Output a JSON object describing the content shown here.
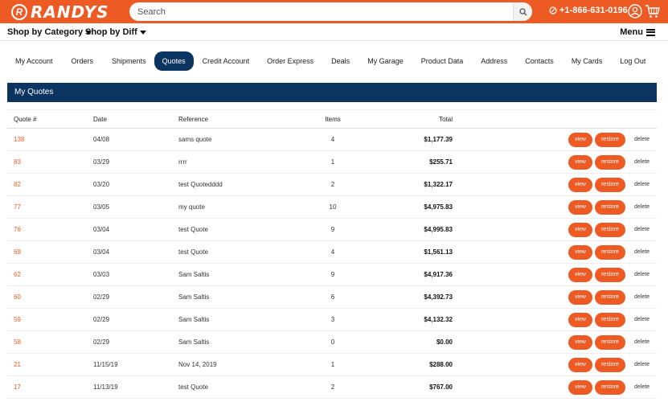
{
  "header": {
    "logo_badge": "R",
    "logo_text": "RANDYS",
    "search_placeholder": "Search",
    "phone": "+1-866-631-0196",
    "icons": [
      "search-icon",
      "phone-icon",
      "account-icon",
      "cart-icon"
    ],
    "brand_color": "#ee5a24"
  },
  "nav": {
    "shop_category": "Shop by Category",
    "shop_diff": "Shop by Diff",
    "menu": "Menu"
  },
  "tabs": [
    {
      "label": "My Account"
    },
    {
      "label": "Orders"
    },
    {
      "label": "Shipments"
    },
    {
      "label": "Quotes",
      "active": true
    },
    {
      "label": "Credit Account"
    },
    {
      "label": "Order Express"
    },
    {
      "label": "Deals"
    },
    {
      "label": "My Garage"
    },
    {
      "label": "Product Data"
    },
    {
      "label": "Address"
    },
    {
      "label": "Contacts"
    },
    {
      "label": "My Cards"
    },
    {
      "label": "Log Out"
    }
  ],
  "panel": {
    "title": "My Quotes",
    "header_color": "#0b3560"
  },
  "table": {
    "columns": {
      "quote": "Quote #",
      "date": "Date",
      "reference": "Reference",
      "items": "Items",
      "total": "Total"
    },
    "actions": {
      "view": "view",
      "restore": "restore",
      "delete": "delete"
    },
    "rows": [
      {
        "quote": "138",
        "date": "04/08",
        "reference": "sams quote",
        "items": "4",
        "total": "$1,177.39"
      },
      {
        "quote": "83",
        "date": "03/29",
        "reference": "rrrr",
        "items": "1",
        "total": "$255.71"
      },
      {
        "quote": "82",
        "date": "03/20",
        "reference": "test Quotedddd",
        "items": "2",
        "total": "$1,322.17"
      },
      {
        "quote": "77",
        "date": "03/05",
        "reference": "my quote",
        "items": "10",
        "total": "$4,975.83"
      },
      {
        "quote": "76",
        "date": "03/04",
        "reference": "test Quote",
        "items": "9",
        "total": "$4,995.83"
      },
      {
        "quote": "69",
        "date": "03/04",
        "reference": "test Quote",
        "items": "4",
        "total": "$1,561.13"
      },
      {
        "quote": "62",
        "date": "03/03",
        "reference": "Sam Saltis",
        "items": "9",
        "total": "$4,917.36"
      },
      {
        "quote": "60",
        "date": "02/29",
        "reference": "Sam Saltis",
        "items": "6",
        "total": "$4,392.73"
      },
      {
        "quote": "59",
        "date": "02/29",
        "reference": "Sam Saltis",
        "items": "3",
        "total": "$4,132.32"
      },
      {
        "quote": "58",
        "date": "02/29",
        "reference": "Sam Saltis",
        "items": "0",
        "total": "$0.00"
      },
      {
        "quote": "21",
        "date": "11/15/19",
        "reference": "Nov 14, 2019",
        "items": "1",
        "total": "$288.00"
      },
      {
        "quote": "17",
        "date": "11/13/19",
        "reference": "test Quote",
        "items": "2",
        "total": "$767.00"
      }
    ]
  }
}
